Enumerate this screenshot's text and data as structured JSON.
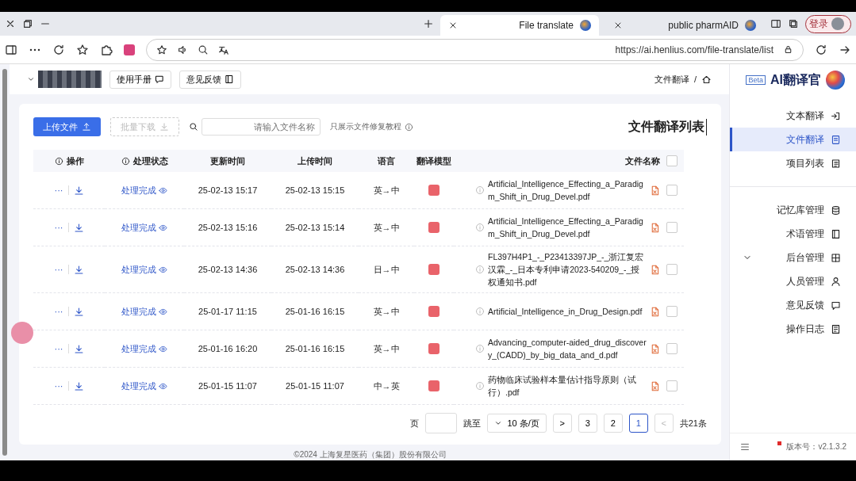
{
  "browser": {
    "tabs": [
      {
        "title": "File translate",
        "selected": true
      },
      {
        "title": "public pharmAID",
        "selected": false
      }
    ],
    "profile": "登录",
    "url": "https://ai.henlius.com/file-translate/list"
  },
  "sidebar": {
    "logo": "AI翻译官",
    "badge": "Beta",
    "items": [
      {
        "label": "文本翻译",
        "selected": false
      },
      {
        "label": "文件翻译",
        "selected": true
      },
      {
        "label": "项目列表",
        "selected": false
      },
      {
        "kind": "divider"
      },
      {
        "label": "记忆库管理",
        "selected": false
      },
      {
        "label": "术语管理",
        "selected": false
      },
      {
        "label": "后台管理",
        "selected": false,
        "expanded": true,
        "children": [
          {
            "label": "人员管理",
            "selected": false
          },
          {
            "label": "意见反馈",
            "selected": false
          },
          {
            "label": "操作日志",
            "selected": false
          }
        ]
      }
    ],
    "version": "版本号：v2.1.3.2"
  },
  "header": {
    "separator": "/",
    "breadcrumb": "文件翻译",
    "buttons": [
      "使用手册",
      "意见反馈"
    ]
  },
  "card": {
    "title": "文件翻译列表",
    "upload": "上传文件",
    "batch_download": {
      "label": "批量下载",
      "disabled": true
    },
    "search": {
      "placeholder": "请输入文件名称"
    },
    "note": "只展示文件修复教程",
    "table": {
      "columns": [
        "操作",
        "处理状态",
        "更新时间",
        "上传时间",
        "语言",
        "翻译模型",
        "文件名称"
      ],
      "all_checked": false,
      "rows": [
        {
          "checked": false,
          "name": "Artificial_Intelligence_Effecting_a_Paradigm_Shift_in_Drug_Devel.pdf",
          "lang": "英→中",
          "uploaded": "25-02-13 15:15",
          "updated": "25-02-13 15:17",
          "status": "处理完成",
          "more": "···"
        },
        {
          "checked": false,
          "name": "Artificial_Intelligence_Effecting_a_Paradigm_Shift_in_Drug_Devel.pdf",
          "lang": "英→中",
          "uploaded": "25-02-13 15:14",
          "updated": "25-02-13 15:16",
          "status": "处理完成",
          "more": "···"
        },
        {
          "checked": false,
          "name": "FL397H4P1_-_P23413397JP_-_浙江复宏汉霖_-_日本专利申请2023-540209_-_授权通知书.pdf",
          "lang": "日→中",
          "uploaded": "25-02-13 14:36",
          "updated": "25-02-13 14:36",
          "status": "处理完成",
          "more": "···"
        },
        {
          "checked": false,
          "name": "Artificial_Intelligence_in_Drug_Design.pdf",
          "lang": "英→中",
          "uploaded": "25-01-16 16:15",
          "updated": "25-01-17 11:15",
          "status": "处理完成",
          "more": "···"
        },
        {
          "checked": false,
          "name": "Advancing_computer-aided_drug_discovery_(CADD)_by_big_data_and_d.pdf",
          "lang": "英→中",
          "uploaded": "25-01-16 16:15",
          "updated": "25-01-16 16:20",
          "status": "处理完成",
          "more": "···"
        },
        {
          "checked": false,
          "name": "药物临床试验样本量估计指导原则（试行）.pdf",
          "lang": "中→英",
          "uploaded": "25-01-15 11:07",
          "updated": "25-01-15 11:07",
          "status": "处理完成",
          "more": "···"
        }
      ]
    },
    "pager": {
      "total": "共21条",
      "prev": "<",
      "pages": [
        {
          "label": "3",
          "selected": false
        },
        {
          "label": "2",
          "selected": false
        },
        {
          "label": "1",
          "selected": true
        }
      ],
      "next": ">",
      "size": "10 条/页",
      "jump": "跳至",
      "unit": "页"
    }
  },
  "footer": "©2024 上海复星医药（集团）股份有限公司"
}
